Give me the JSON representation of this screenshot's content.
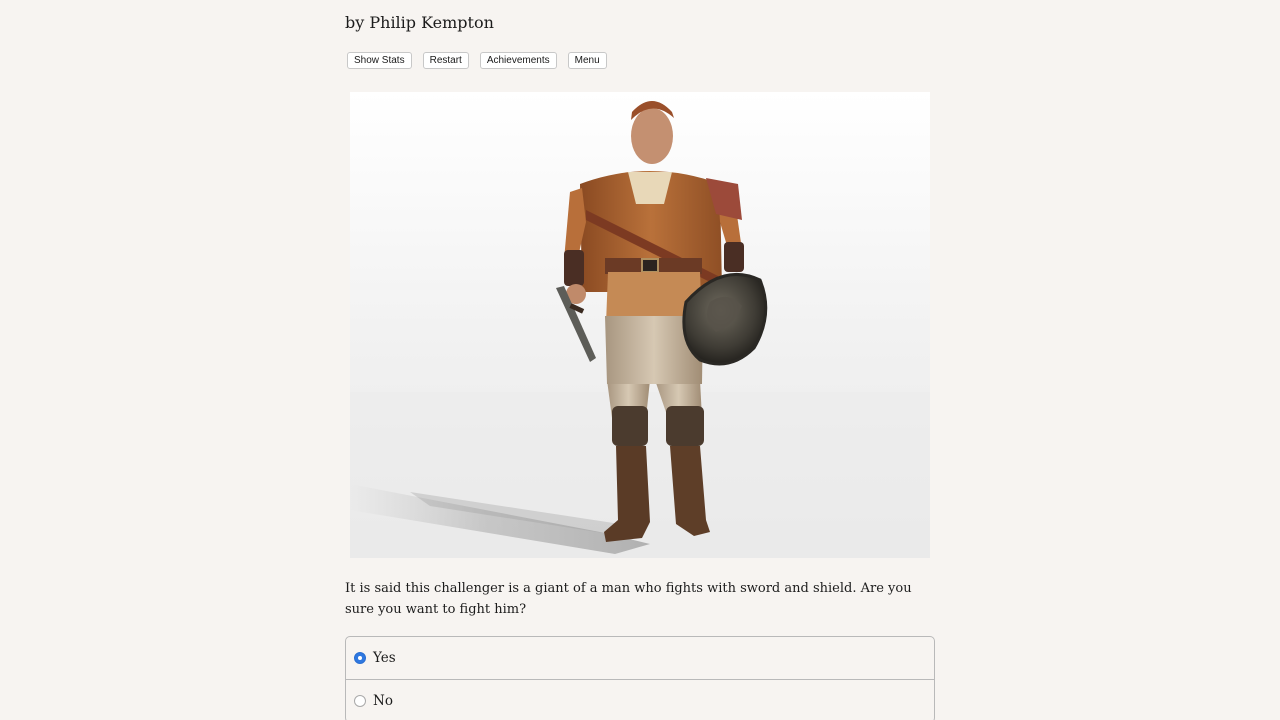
{
  "header": {
    "author": "by Philip Kempton"
  },
  "toolbar": {
    "show_stats": "Show Stats",
    "restart": "Restart",
    "achievements": "Achievements",
    "menu": "Menu"
  },
  "scene": {
    "image_subject": "armored warrior with sword and shield",
    "text": "It is said this challenger is a giant of a man who fights with sword and shield. Are you sure you want to fight him?"
  },
  "choices": [
    {
      "label": "Yes",
      "selected": true
    },
    {
      "label": "No",
      "selected": false
    }
  ],
  "colors": {
    "background": "#f7f4f1",
    "radio_selected": "#2f78e0"
  }
}
